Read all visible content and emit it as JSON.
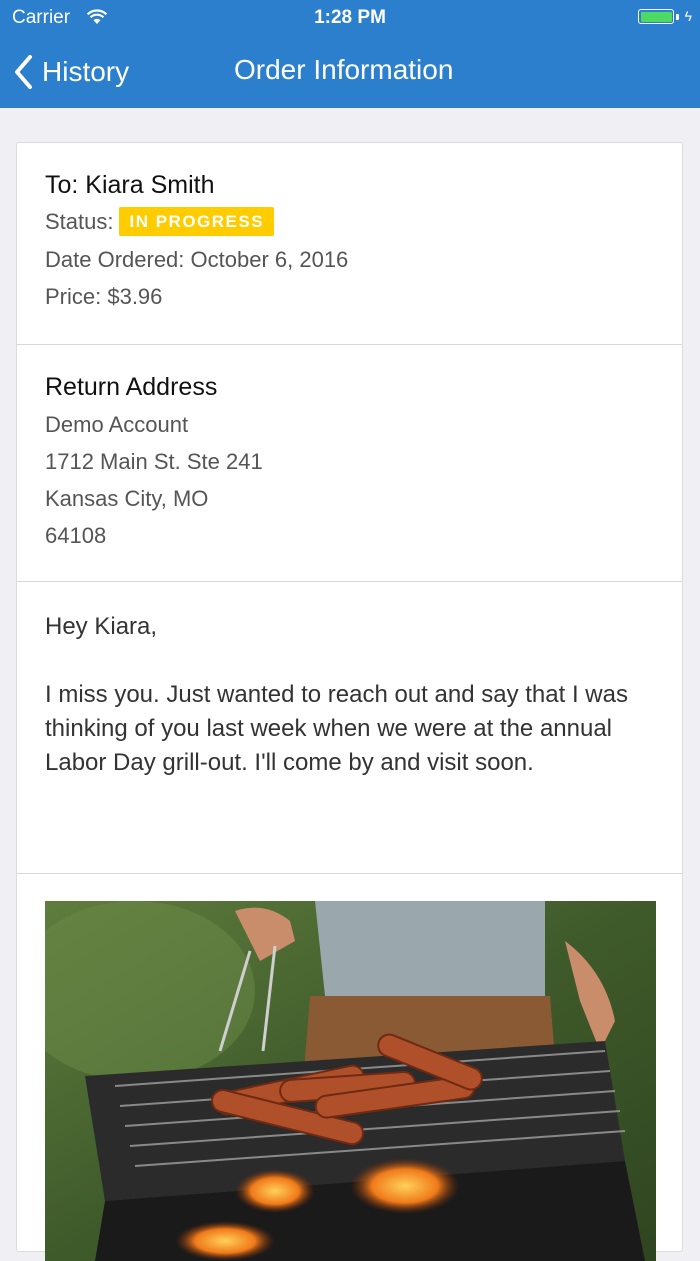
{
  "status_bar": {
    "carrier": "Carrier",
    "time": "1:28 PM",
    "wifi_icon": "wifi-icon",
    "battery_icon": "battery-icon",
    "charging_icon": "bolt-icon"
  },
  "nav": {
    "back_label": "History",
    "back_icon": "chevron-left-icon",
    "title": "Order Information",
    "bar_color": "#2b7fcc"
  },
  "order": {
    "recipient": "To: Kiara Smith",
    "status_label": "Status:",
    "status_value": "IN PROGRESS",
    "status_color": "#ffcc00",
    "date_ordered": "Date Ordered: October 6, 2016",
    "price": "Price: $3.96"
  },
  "return_address": {
    "heading": "Return Address",
    "name": "Demo Account",
    "street": "1712 Main St. Ste 241",
    "city_state": "Kansas City, MO",
    "zip": "64108"
  },
  "message": {
    "greeting": "Hey Kiara,",
    "body": "I miss you. Just wanted to reach out and say that I was thinking of you last week when we were at the annual Labor Day grill-out. I'll come by and visit soon."
  },
  "photo": {
    "subject": "grill-photo"
  }
}
